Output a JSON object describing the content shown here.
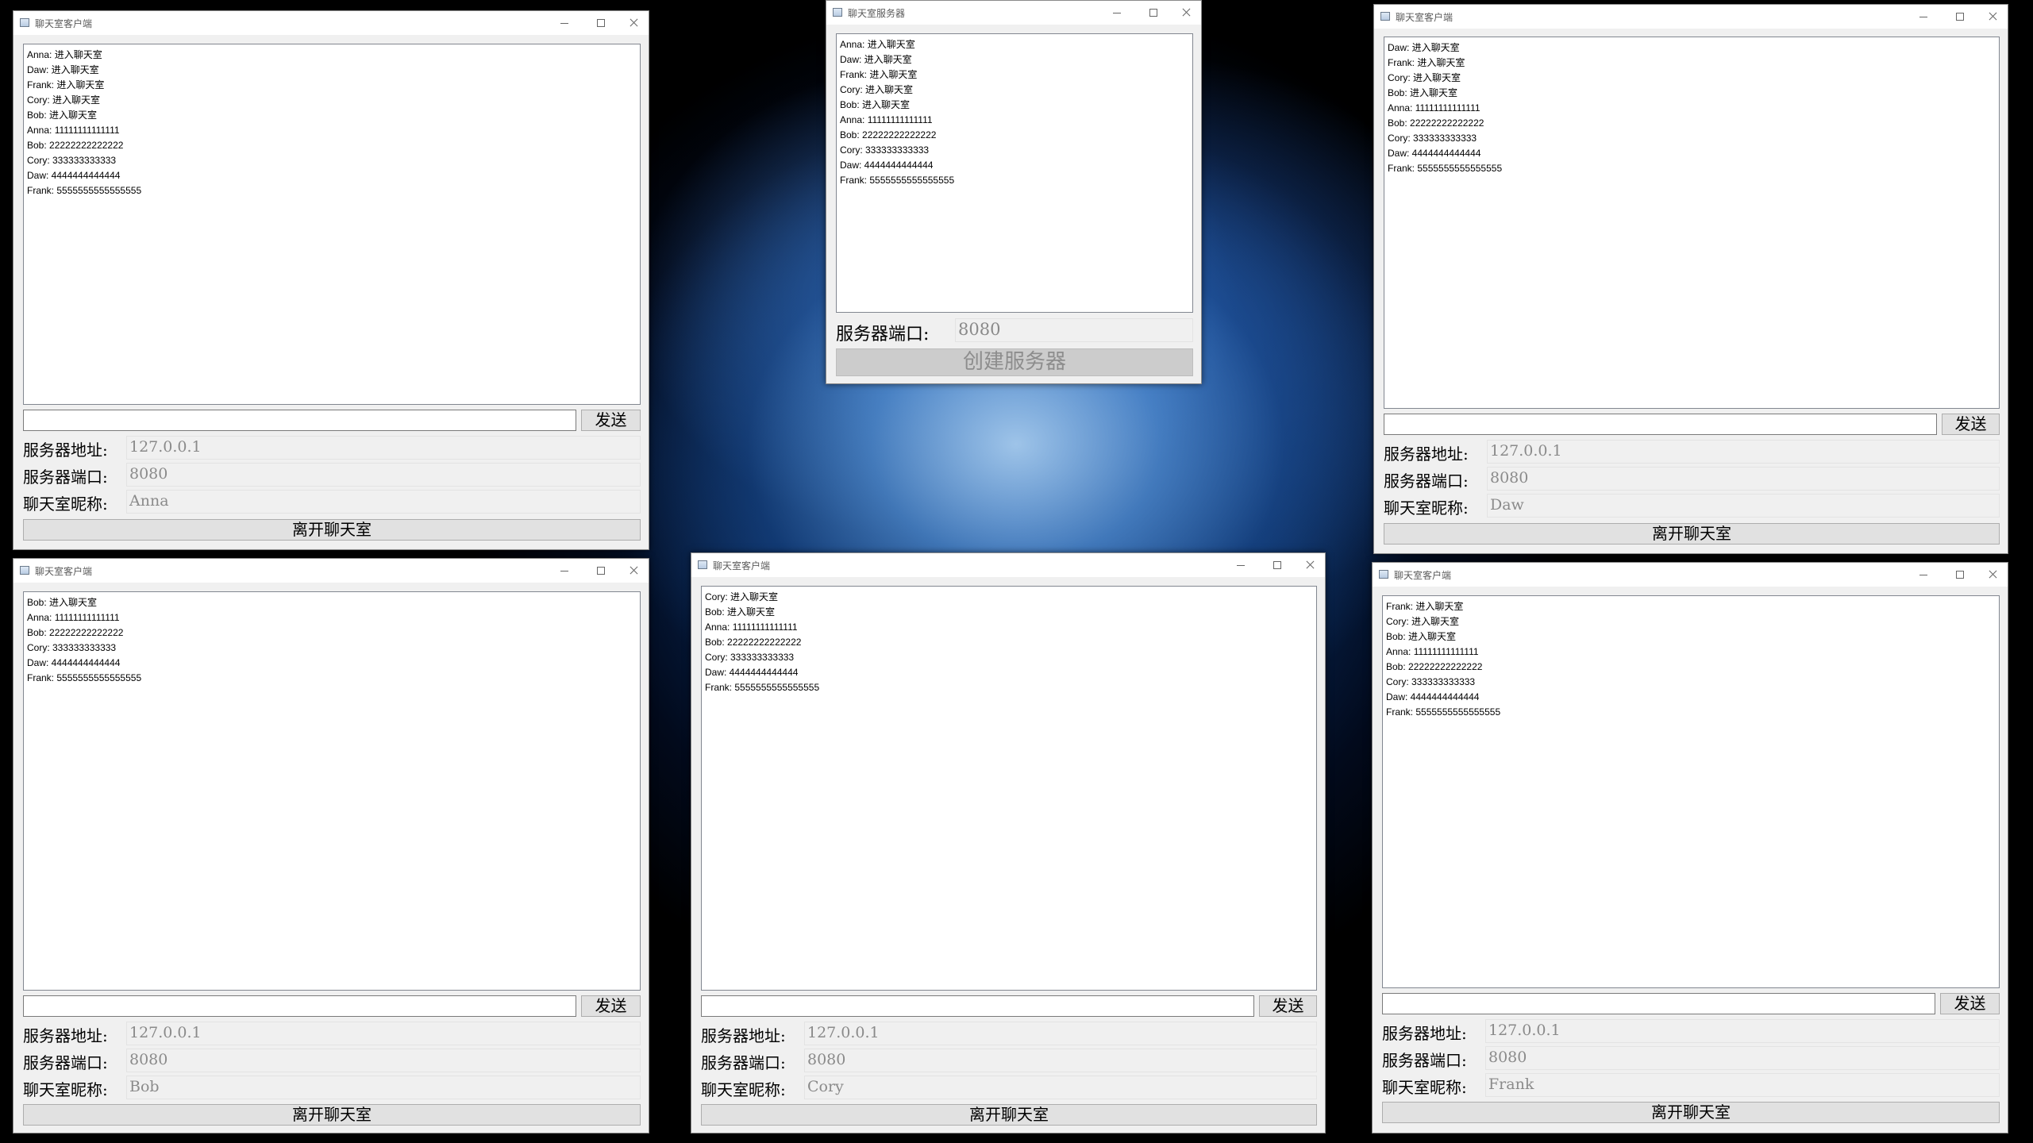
{
  "client_title": "聊天室客户端",
  "server_title": "聊天室服务器",
  "labels": {
    "address": "服务器地址:",
    "port": "服务器端口:",
    "nickname": "聊天室昵称:",
    "send": "发送",
    "leave": "离开聊天室",
    "create_server": "创建服务器"
  },
  "server": {
    "port": "8080",
    "messages": [
      "Anna: 进入聊天室",
      "Daw: 进入聊天室",
      "Frank: 进入聊天室",
      "Cory: 进入聊天室",
      "Bob: 进入聊天室",
      "Anna: 11111111111111",
      "Bob: 22222222222222",
      "Cory: 333333333333",
      "Daw: 4444444444444",
      "Frank: 5555555555555555"
    ]
  },
  "clients": {
    "anna": {
      "address": "127.0.0.1",
      "port": "8080",
      "nickname": "Anna",
      "messages": [
        "Anna: 进入聊天室",
        "Daw: 进入聊天室",
        "Frank: 进入聊天室",
        "Cory: 进入聊天室",
        "Bob: 进入聊天室",
        "Anna: 11111111111111",
        "Bob: 22222222222222",
        "Cory: 333333333333",
        "Daw: 4444444444444",
        "Frank: 5555555555555555"
      ]
    },
    "daw": {
      "address": "127.0.0.1",
      "port": "8080",
      "nickname": "Daw",
      "messages": [
        "Daw: 进入聊天室",
        "Frank: 进入聊天室",
        "Cory: 进入聊天室",
        "Bob: 进入聊天室",
        "Anna: 11111111111111",
        "Bob: 22222222222222",
        "Cory: 333333333333",
        "Daw: 4444444444444",
        "Frank: 5555555555555555"
      ]
    },
    "bob": {
      "address": "127.0.0.1",
      "port": "8080",
      "nickname": "Bob",
      "messages": [
        "Bob: 进入聊天室",
        "Anna: 11111111111111",
        "Bob: 22222222222222",
        "Cory: 333333333333",
        "Daw: 4444444444444",
        "Frank: 5555555555555555"
      ]
    },
    "cory": {
      "address": "127.0.0.1",
      "port": "8080",
      "nickname": "Cory",
      "messages": [
        "Cory: 进入聊天室",
        "Bob: 进入聊天室",
        "Anna: 11111111111111",
        "Bob: 22222222222222",
        "Cory: 333333333333",
        "Daw: 4444444444444",
        "Frank: 5555555555555555"
      ]
    },
    "frank": {
      "address": "127.0.0.1",
      "port": "8080",
      "nickname": "Frank",
      "messages": [
        "Frank: 进入聊天室",
        "Cory: 进入聊天室",
        "Bob: 进入聊天室",
        "Anna: 11111111111111",
        "Bob: 22222222222222",
        "Cory: 333333333333",
        "Daw: 4444444444444",
        "Frank: 5555555555555555"
      ]
    }
  }
}
